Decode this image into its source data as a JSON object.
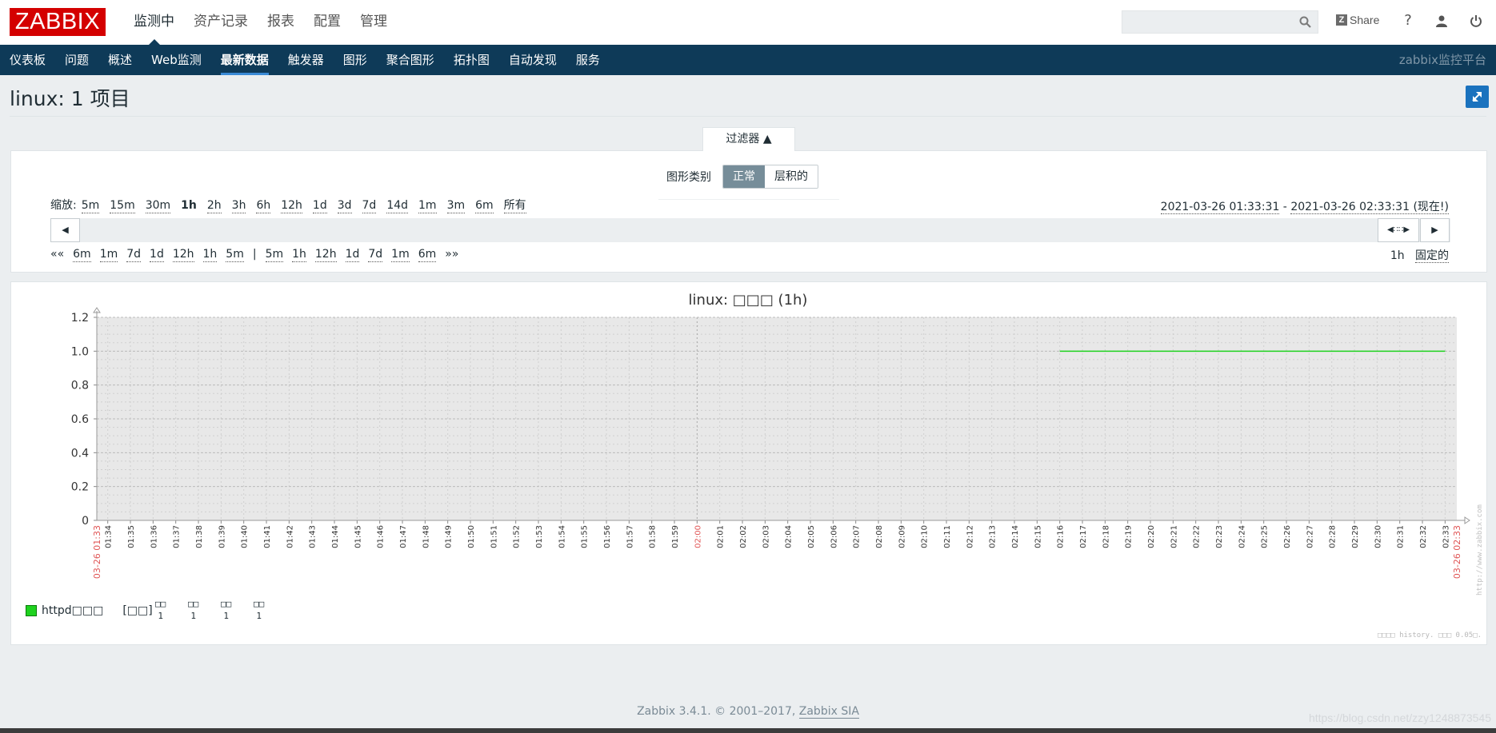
{
  "header": {
    "logo": "ZABBIX",
    "menu": [
      "监测中",
      "资产记录",
      "报表",
      "配置",
      "管理"
    ],
    "active_menu": 0,
    "share_label": "Share",
    "help_label": "?"
  },
  "nav": {
    "items": [
      "仪表板",
      "问题",
      "概述",
      "Web监测",
      "最新数据",
      "触发器",
      "图形",
      "聚合图形",
      "拓扑图",
      "自动发现",
      "服务"
    ],
    "active": 4,
    "right_text": "zabbix监控平台"
  },
  "page": {
    "title": "linux: 1 项目"
  },
  "filter": {
    "tab_label": "过滤器 ▲",
    "graph_type_label": "图形类别",
    "graph_type_options": [
      "正常",
      "层积的"
    ],
    "graph_type_selected": 0,
    "zoom_label": "缩放:",
    "zoom_options": [
      "5m",
      "15m",
      "30m",
      "1h",
      "2h",
      "3h",
      "6h",
      "12h",
      "1d",
      "3d",
      "7d",
      "14d",
      "1m",
      "3m",
      "6m",
      "所有"
    ],
    "zoom_current": "1h",
    "range_from": "2021-03-26 01:33:31",
    "range_sep": " - ",
    "range_to": "2021-03-26 02:33:31 (现在!)",
    "nav_back": [
      "««",
      "6m",
      "1m",
      "7d",
      "1d",
      "12h",
      "1h",
      "5m"
    ],
    "nav_divider": "|",
    "nav_fwd": [
      "5m",
      "1h",
      "12h",
      "1d",
      "7d",
      "1m",
      "6m",
      "»»"
    ],
    "period": "1h",
    "fixed_label": "固定的"
  },
  "graph": {
    "title": "linux: □□□ (1h)",
    "legend_item": "httpd□□□",
    "legend_func": "[□□]",
    "stat_headers": [
      "□□",
      "□□",
      "□□",
      "□□"
    ],
    "stat_values": [
      "1",
      "1",
      "1",
      "1"
    ],
    "watermark": "http://www.zabbix.com",
    "footer_note": "□□□□ history. □□□ 0.05□."
  },
  "chart_data": {
    "type": "line",
    "title": "linux: □□□ (1h)",
    "ylim": [
      0,
      1.2
    ],
    "y_ticks": [
      "0",
      "0.2",
      "0.4",
      "0.6",
      "0.8",
      "1.0",
      "1.2"
    ],
    "x_ticks": [
      "01:34",
      "01:35",
      "01:36",
      "01:37",
      "01:38",
      "01:39",
      "01:40",
      "01:41",
      "01:42",
      "01:43",
      "01:44",
      "01:45",
      "01:46",
      "01:47",
      "01:48",
      "01:49",
      "01:50",
      "01:51",
      "01:52",
      "01:53",
      "01:54",
      "01:55",
      "01:56",
      "01:57",
      "01:58",
      "01:59",
      "02:00",
      "02:01",
      "02:02",
      "02:03",
      "02:04",
      "02:05",
      "02:06",
      "02:07",
      "02:08",
      "02:09",
      "02:10",
      "02:11",
      "02:12",
      "02:13",
      "02:14",
      "02:15",
      "02:16",
      "02:17",
      "02:18",
      "02:19",
      "02:20",
      "02:21",
      "02:22",
      "02:23",
      "02:24",
      "02:25",
      "02:26",
      "02:27",
      "02:28",
      "02:29",
      "02:30",
      "02:31",
      "02:32",
      "02:33"
    ],
    "x_start_label": "03-26 01:33",
    "x_end_label": "03-26 02:33",
    "grid": true,
    "series": [
      {
        "name": "httpd□□□",
        "color": "#1fd21f",
        "x": [
          "02:16",
          "02:33"
        ],
        "values": [
          1,
          1
        ]
      }
    ]
  },
  "footer": {
    "text": "Zabbix 3.4.1. © 2001–2017, ",
    "link": "Zabbix SIA",
    "watermark": "https://blog.csdn.net/zzy1248873545"
  }
}
